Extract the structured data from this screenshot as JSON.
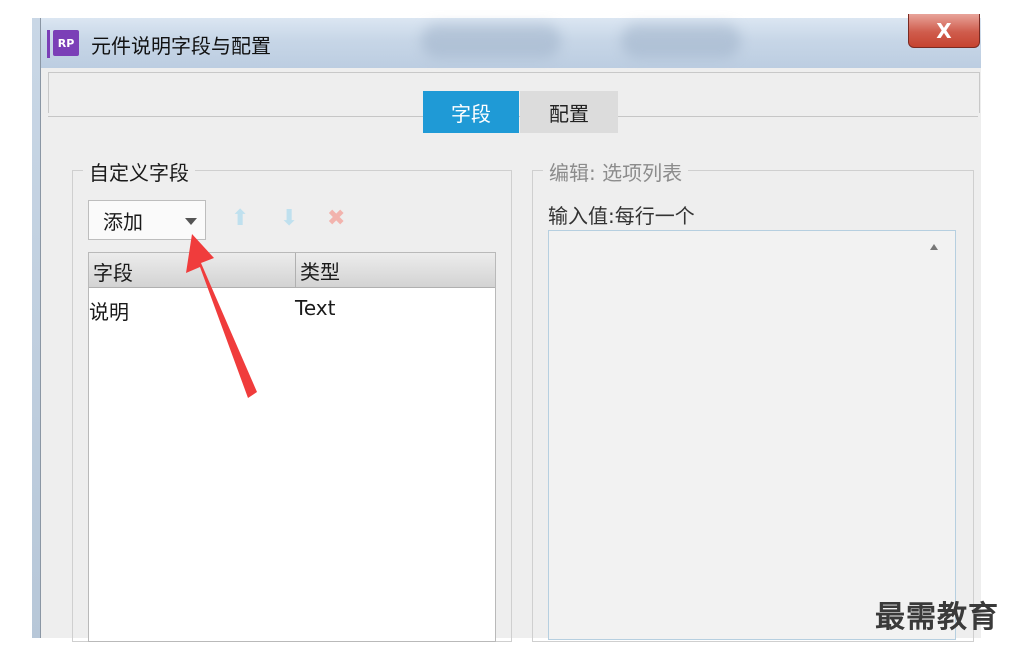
{
  "window": {
    "title": "元件说明字段与配置",
    "app_icon_text": "RP",
    "close_label": "X"
  },
  "tabs": [
    {
      "label": "字段",
      "active": true
    },
    {
      "label": "配置",
      "active": false
    }
  ],
  "custom_fields": {
    "legend": "自定义字段",
    "add_label": "添加",
    "table": {
      "headers": [
        "字段",
        "类型"
      ],
      "rows": [
        {
          "field": "说明",
          "type": "Text"
        }
      ]
    }
  },
  "editor": {
    "legend": "编辑: 选项列表",
    "input_label": "输入值:每行一个",
    "value": ""
  },
  "watermark": "最需教育",
  "colors": {
    "accent": "#1f9ad6",
    "annotation_arrow": "#f03c3c"
  },
  "icons": [
    "move-up-icon",
    "move-down-icon",
    "delete-icon",
    "dropdown-caret-icon"
  ]
}
